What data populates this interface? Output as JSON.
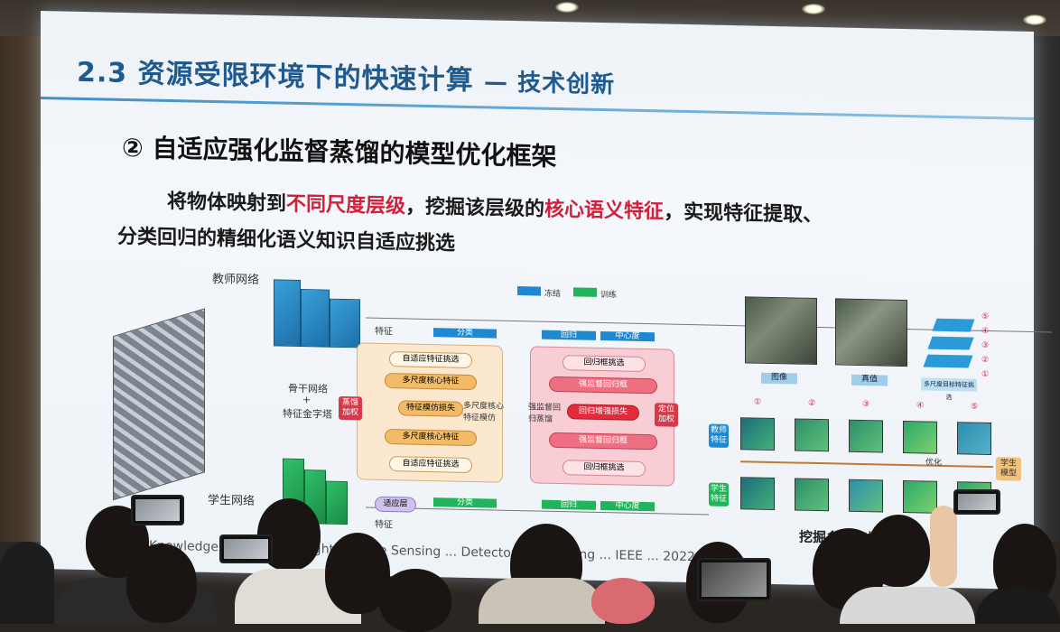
{
  "slide": {
    "title": "2.3 资源受限环境下的快速计算",
    "title_suffix": "— 技术创新",
    "heading": "② 自适应强化监督蒸馏的模型优化框架",
    "para_line1_a": "将物体映射到",
    "para_line1_b": "不同尺度层级",
    "para_line1_c": "，挖掘该层级的",
    "para_line1_d": "核心语义特征",
    "para_line1_e": "，实现特征提取、",
    "para_line2": "分类回归的精细化语义知识自适应挑选"
  },
  "diagram": {
    "teacher_net": "教师网络",
    "student_net": "学生网络",
    "backbone": "骨干网络",
    "plus": "+",
    "fpn": "特征金字塔",
    "feature_top": "特征",
    "feature_bottom": "特征",
    "legend_frozen": "冻结",
    "legend_train": "训练",
    "cls_top": "分类",
    "cls_bottom": "分类",
    "reg_top": "回归",
    "reg_bottom": "回归",
    "center_top": "中心度",
    "center_bottom": "中心度",
    "adapt_small": "适应层",
    "left_panel": [
      "自适应特征挑选",
      "多尺度核心特征",
      "特征模仿损失",
      "多尺度核心特征",
      "自适应特征挑选"
    ],
    "left_side_tag": "蒸馏加权",
    "left_right_note": "多尺度核心特征模仿",
    "right_panel": [
      "回归框挑选",
      "强监督回归框",
      "回归增强损失",
      "强监督回归框",
      "回归框挑选"
    ],
    "right_side_tag": "定位加权",
    "right_left_note": "强监督回归蒸馏",
    "img_label_a": "图像",
    "img_label_b": "真值",
    "pyramid_note": "多尺度目标特征挑选",
    "circled": [
      "①",
      "②",
      "③",
      "④",
      "⑤"
    ],
    "teacher_feat": "教师特征",
    "student_feat": "学生特征",
    "optimize": "优化",
    "student_model": "学生模型",
    "mine_caption": "挖掘多尺度核心特征",
    "footer_partial": "Knowledge ... for Lightweight Remote Sensing ... Detectors Optimizing ... IEEE ... 2022"
  },
  "colors": {
    "title": "#1f5a8f",
    "accent_red": "#d0213a",
    "frozen": "#1e88d0",
    "train": "#21b45a"
  }
}
